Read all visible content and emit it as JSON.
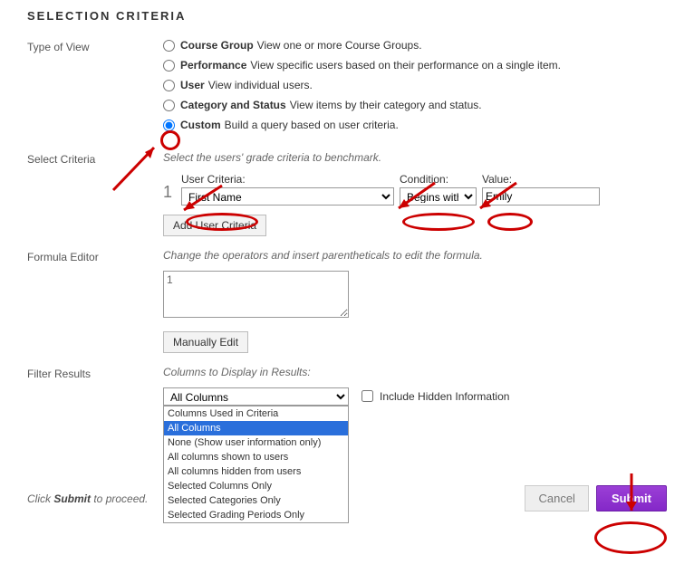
{
  "heading": "SELECTION CRITERIA",
  "labels": {
    "typeOfView": "Type of View",
    "selectCriteria": "Select Criteria",
    "formulaEditor": "Formula Editor",
    "filterResults": "Filter Results"
  },
  "viewOptions": [
    {
      "bold": "Course Group",
      "desc": "View one or more Course Groups."
    },
    {
      "bold": "Performance",
      "desc": "View specific users based on their performance on a single item."
    },
    {
      "bold": "User",
      "desc": "View individual users."
    },
    {
      "bold": "Category and Status",
      "desc": "View items by their category and status."
    },
    {
      "bold": "Custom",
      "desc": "Build a query based on user criteria."
    }
  ],
  "selectCriteriaNote": "Select the users' grade criteria to benchmark.",
  "criteria": {
    "num": "1",
    "userCriteriaLabel": "User Criteria:",
    "userCriteriaValue": "First Name",
    "conditionLabel": "Condition:",
    "conditionValue": "Begins with",
    "valueLabel": "Value:",
    "valueValue": "Emily",
    "addBtn": "Add User Criteria"
  },
  "formula": {
    "note": "Change the operators and insert parentheticals to edit the formula.",
    "text": "1",
    "editBtn": "Manually Edit"
  },
  "filter": {
    "note": "Columns to Display in Results:",
    "selectedShown": "All Columns",
    "options": [
      "Columns Used in Criteria",
      "All Columns",
      "None (Show user information only)",
      "All columns shown to users",
      "All columns hidden from users",
      "Selected Columns Only",
      "Selected Categories Only",
      "Selected Grading Periods Only"
    ],
    "includeHidden": "Include Hidden Information"
  },
  "proceed": {
    "pre": "Click ",
    "bold": "Submit",
    "post": " to proceed."
  },
  "buttons": {
    "cancel": "Cancel",
    "submit": "Submit"
  }
}
